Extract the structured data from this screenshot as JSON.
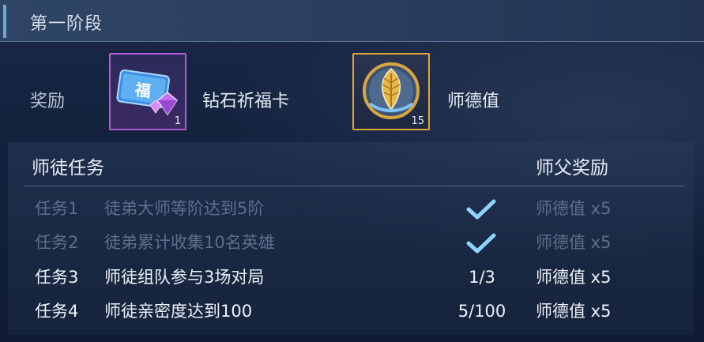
{
  "stage": {
    "title": "第一阶段"
  },
  "rewards": {
    "label": "奖励",
    "items": [
      {
        "name": "钻石祈福卡",
        "count": "1",
        "icon": "blessing-card-icon",
        "border_color": "#b45bd6"
      },
      {
        "name": "师德值",
        "count": "15",
        "icon": "golden-leaf-emblem-icon",
        "border_color": "#e2a634"
      }
    ]
  },
  "task_table": {
    "header_task": "师徒任务",
    "header_reward": "师父奖励",
    "rows": [
      {
        "id": "任务1",
        "desc": "徒弟大师等阶达到5阶",
        "progress": "",
        "done": true,
        "reward": "师德值 x5"
      },
      {
        "id": "任务2",
        "desc": "徒弟累计收集10名英雄",
        "progress": "",
        "done": true,
        "reward": "师德值 x5"
      },
      {
        "id": "任务3",
        "desc": "师徒组队参与3场对局",
        "progress": "1/3",
        "done": false,
        "reward": "师德值 x5"
      },
      {
        "id": "任务4",
        "desc": "师徒亲密度达到100",
        "progress": "5/100",
        "done": false,
        "reward": "师德值 x5"
      }
    ]
  },
  "colors": {
    "completed_text": "#5d6f8a",
    "active_text": "#eef2f8",
    "check": "#8fd3ff"
  }
}
